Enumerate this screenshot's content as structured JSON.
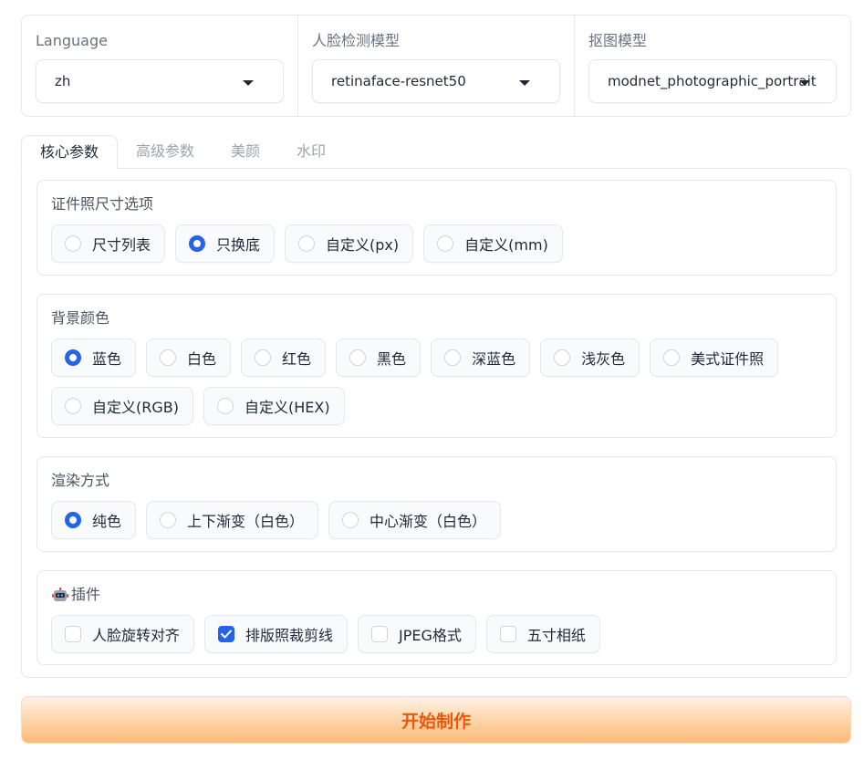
{
  "dropdowns": [
    {
      "label": "Language",
      "value": "zh"
    },
    {
      "label": "人脸检测模型",
      "value": "retinaface-resnet50"
    },
    {
      "label": "抠图模型",
      "value": "modnet_photographic_portrait"
    }
  ],
  "tabs": [
    {
      "label": "核心参数",
      "active": true
    },
    {
      "label": "高级参数",
      "active": false
    },
    {
      "label": "美颜",
      "active": false
    },
    {
      "label": "水印",
      "active": false
    }
  ],
  "size_options": {
    "label": "证件照尺寸选项",
    "options": [
      {
        "label": "尺寸列表",
        "selected": false
      },
      {
        "label": "只换底",
        "selected": true
      },
      {
        "label": "自定义(px)",
        "selected": false
      },
      {
        "label": "自定义(mm)",
        "selected": false
      }
    ]
  },
  "background_color": {
    "label": "背景颜色",
    "options": [
      {
        "label": "蓝色",
        "selected": true
      },
      {
        "label": "白色",
        "selected": false
      },
      {
        "label": "红色",
        "selected": false
      },
      {
        "label": "黑色",
        "selected": false
      },
      {
        "label": "深蓝色",
        "selected": false
      },
      {
        "label": "浅灰色",
        "selected": false
      },
      {
        "label": "美式证件照",
        "selected": false
      },
      {
        "label": "自定义(RGB)",
        "selected": false
      },
      {
        "label": "自定义(HEX)",
        "selected": false
      }
    ]
  },
  "render_mode": {
    "label": "渲染方式",
    "options": [
      {
        "label": "纯色",
        "selected": true
      },
      {
        "label": "上下渐变（白色）",
        "selected": false
      },
      {
        "label": "中心渐变（白色）",
        "selected": false
      }
    ]
  },
  "plugins": {
    "label": "插件",
    "icon": "robot-icon",
    "options": [
      {
        "label": "人脸旋转对齐",
        "checked": false
      },
      {
        "label": "排版照裁剪线",
        "checked": true
      },
      {
        "label": "JPEG格式",
        "checked": false
      },
      {
        "label": "五寸相纸",
        "checked": false
      }
    ]
  },
  "start_button": {
    "label": "开始制作"
  },
  "colors": {
    "accent": "#2563eb",
    "button_text": "#ea580c",
    "button_gradient_end": "#fdba74"
  }
}
